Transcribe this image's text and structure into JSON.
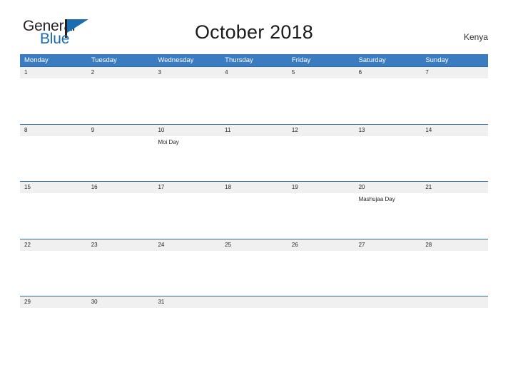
{
  "brand": {
    "name_part1": "General",
    "name_part2": "Blue",
    "flag_icon": "flag-triangle-icon",
    "accent_color": "#1b6cb0"
  },
  "header": {
    "title": "October 2018",
    "country": "Kenya"
  },
  "colors": {
    "header_blue": "#3b7cc0",
    "rule_blue": "#2e6da4",
    "date_band_gray": "#f0f0f0",
    "text_dark": "#262626",
    "page_background": "#ffffff"
  },
  "calendar": {
    "weekday_headers": [
      "Monday",
      "Tuesday",
      "Wednesday",
      "Thursday",
      "Friday",
      "Saturday",
      "Sunday"
    ],
    "weeks": [
      {
        "days": [
          {
            "date": "1",
            "event": ""
          },
          {
            "date": "2",
            "event": ""
          },
          {
            "date": "3",
            "event": ""
          },
          {
            "date": "4",
            "event": ""
          },
          {
            "date": "5",
            "event": ""
          },
          {
            "date": "6",
            "event": ""
          },
          {
            "date": "7",
            "event": ""
          }
        ]
      },
      {
        "days": [
          {
            "date": "8",
            "event": ""
          },
          {
            "date": "9",
            "event": ""
          },
          {
            "date": "10",
            "event": "Moi Day"
          },
          {
            "date": "11",
            "event": ""
          },
          {
            "date": "12",
            "event": ""
          },
          {
            "date": "13",
            "event": ""
          },
          {
            "date": "14",
            "event": ""
          }
        ]
      },
      {
        "days": [
          {
            "date": "15",
            "event": ""
          },
          {
            "date": "16",
            "event": ""
          },
          {
            "date": "17",
            "event": ""
          },
          {
            "date": "18",
            "event": ""
          },
          {
            "date": "19",
            "event": ""
          },
          {
            "date": "20",
            "event": "Mashujaa Day"
          },
          {
            "date": "21",
            "event": ""
          }
        ]
      },
      {
        "days": [
          {
            "date": "22",
            "event": ""
          },
          {
            "date": "23",
            "event": ""
          },
          {
            "date": "24",
            "event": ""
          },
          {
            "date": "25",
            "event": ""
          },
          {
            "date": "26",
            "event": ""
          },
          {
            "date": "27",
            "event": ""
          },
          {
            "date": "28",
            "event": ""
          }
        ]
      },
      {
        "days": [
          {
            "date": "29",
            "event": ""
          },
          {
            "date": "30",
            "event": ""
          },
          {
            "date": "31",
            "event": ""
          },
          {
            "date": "",
            "event": ""
          },
          {
            "date": "",
            "event": ""
          },
          {
            "date": "",
            "event": ""
          },
          {
            "date": "",
            "event": ""
          }
        ]
      }
    ]
  }
}
